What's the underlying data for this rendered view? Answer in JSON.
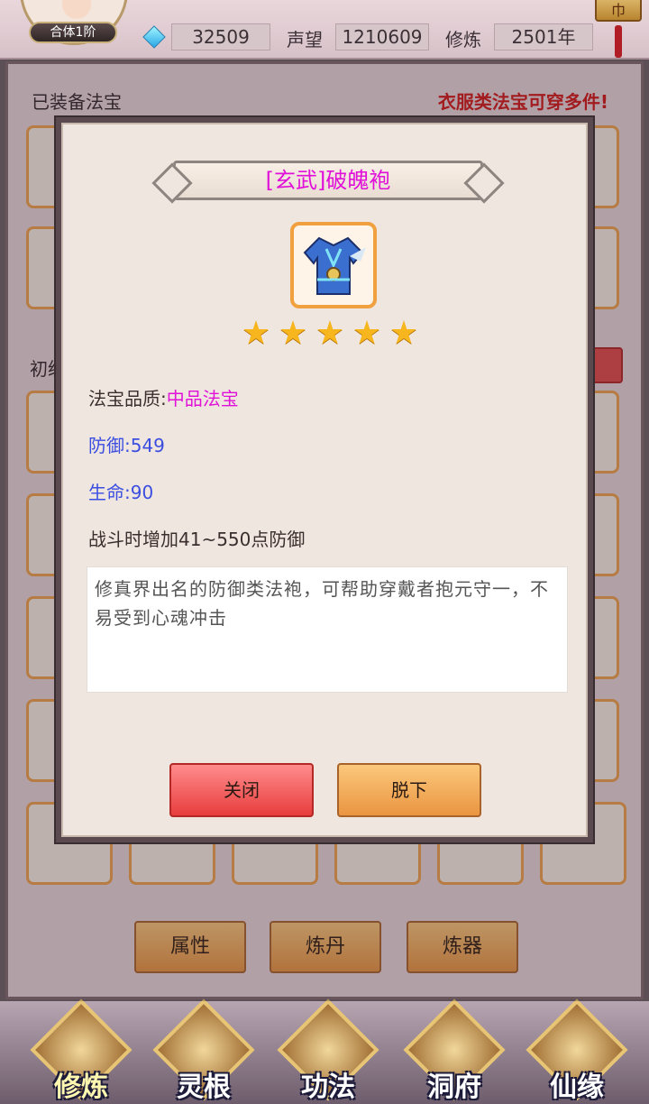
{
  "topbar": {
    "realm": "合体1阶",
    "spirit_stones": "32509",
    "prestige_label": "声望",
    "prestige": "1210609",
    "cultivation_label": "修炼",
    "cultivation": "2501年"
  },
  "panel": {
    "equipped_title": "已装备法宝",
    "equipped_note": "衣服类法宝可穿多件!"
  },
  "bottom_buttons": [
    "属性",
    "炼丹",
    "炼器"
  ],
  "nav": [
    "修炼",
    "灵根",
    "功法",
    "洞府",
    "仙缘"
  ],
  "modal": {
    "title": "[玄武]破魄袍",
    "star_count": 5,
    "quality_label": "法宝品质:",
    "quality_value": "中品法宝",
    "defense": "防御:549",
    "life": "生命:90",
    "effect": "战斗时增加41~550点防御",
    "description": "修真界出名的防御类法袍，可帮助穿戴者抱元守一，不易受到心魂冲击",
    "close_label": "关闭",
    "remove_label": "脱下"
  },
  "colors": {
    "title": "#e010d8",
    "stat": "#3b4ee0",
    "warning": "#d31616",
    "slot_border": "#f0a24a"
  }
}
